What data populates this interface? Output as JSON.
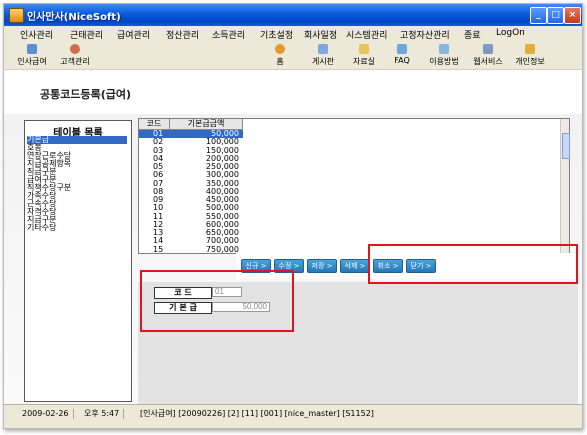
{
  "window": {
    "title": "인사만사(NiceSoft)"
  },
  "menu": [
    {
      "label": "인사관리"
    },
    {
      "label": "근태관리"
    },
    {
      "label": "급여관리"
    },
    {
      "label": "정산관리"
    },
    {
      "label": "소득관리"
    },
    {
      "label": "기초설정"
    },
    {
      "label": "회사일정"
    },
    {
      "label": "시스템관리"
    },
    {
      "label": "고정자산관리"
    },
    {
      "label": "종료"
    },
    {
      "label": "LogOn"
    }
  ],
  "toolbar": {
    "left": [
      {
        "label": "인사급여",
        "icon": "payroll-icon"
      },
      {
        "label": "고객관리",
        "icon": "customer-icon"
      }
    ],
    "right": [
      {
        "label": "홈",
        "icon": "home-icon"
      },
      {
        "label": "게시판",
        "icon": "board-icon"
      },
      {
        "label": "자료실",
        "icon": "archive-icon"
      },
      {
        "label": "FAQ",
        "icon": "faq-icon"
      },
      {
        "label": "이용방법",
        "icon": "guide-icon"
      },
      {
        "label": "웹서비스",
        "icon": "web-service-icon"
      },
      {
        "label": "개인정보",
        "icon": "privacy-icon"
      }
    ]
  },
  "page": {
    "title": "공통코드등록(급여)"
  },
  "table_list": {
    "title": "테이블 목록",
    "items": [
      {
        "label": "기본급",
        "selected": true
      },
      {
        "label": "호봉"
      },
      {
        "label": "연장근로수당"
      },
      {
        "label": "지급공제항목"
      },
      {
        "label": "직급구분"
      },
      {
        "label": "급여구분"
      },
      {
        "label": "직책수당구분"
      },
      {
        "label": "가족수당"
      },
      {
        "label": "근속수당"
      },
      {
        "label": "자격수당"
      },
      {
        "label": "지급구분"
      },
      {
        "label": "기타수당"
      }
    ]
  },
  "grid": {
    "columns": [
      "코드",
      "기본급금액"
    ],
    "rows": [
      {
        "code": "01",
        "amount": "50,000"
      },
      {
        "code": "02",
        "amount": "100,000"
      },
      {
        "code": "03",
        "amount": "150,000"
      },
      {
        "code": "04",
        "amount": "200,000"
      },
      {
        "code": "05",
        "amount": "250,000"
      },
      {
        "code": "06",
        "amount": "300,000"
      },
      {
        "code": "07",
        "amount": "350,000"
      },
      {
        "code": "08",
        "amount": "400,000"
      },
      {
        "code": "09",
        "amount": "450,000"
      },
      {
        "code": "10",
        "amount": "500,000"
      },
      {
        "code": "11",
        "amount": "550,000"
      },
      {
        "code": "12",
        "amount": "600,000"
      },
      {
        "code": "13",
        "amount": "650,000"
      },
      {
        "code": "14",
        "amount": "700,000"
      },
      {
        "code": "15",
        "amount": "750,000"
      }
    ],
    "selected_index": 0
  },
  "actions": [
    {
      "label": "신규 >"
    },
    {
      "label": "수정 >"
    },
    {
      "label": "저장 >"
    },
    {
      "label": "삭제 >"
    },
    {
      "label": "취소 >"
    },
    {
      "label": "닫기 >"
    }
  ],
  "form": {
    "code": {
      "label": "코      드",
      "value": "01"
    },
    "base_pay": {
      "label": "기 본 급",
      "value": "50,000"
    }
  },
  "status": {
    "date": "2009-02-26",
    "time": "오후 5:47",
    "info": "[인사급여] [20090226] [2] [11] [001] [nice_master] [S1152]"
  },
  "colors": {
    "title_bar": "#0a5ad9",
    "highlight": "#316ac5",
    "action_button": "#2478b8",
    "annotation_box": "#e0141a"
  }
}
